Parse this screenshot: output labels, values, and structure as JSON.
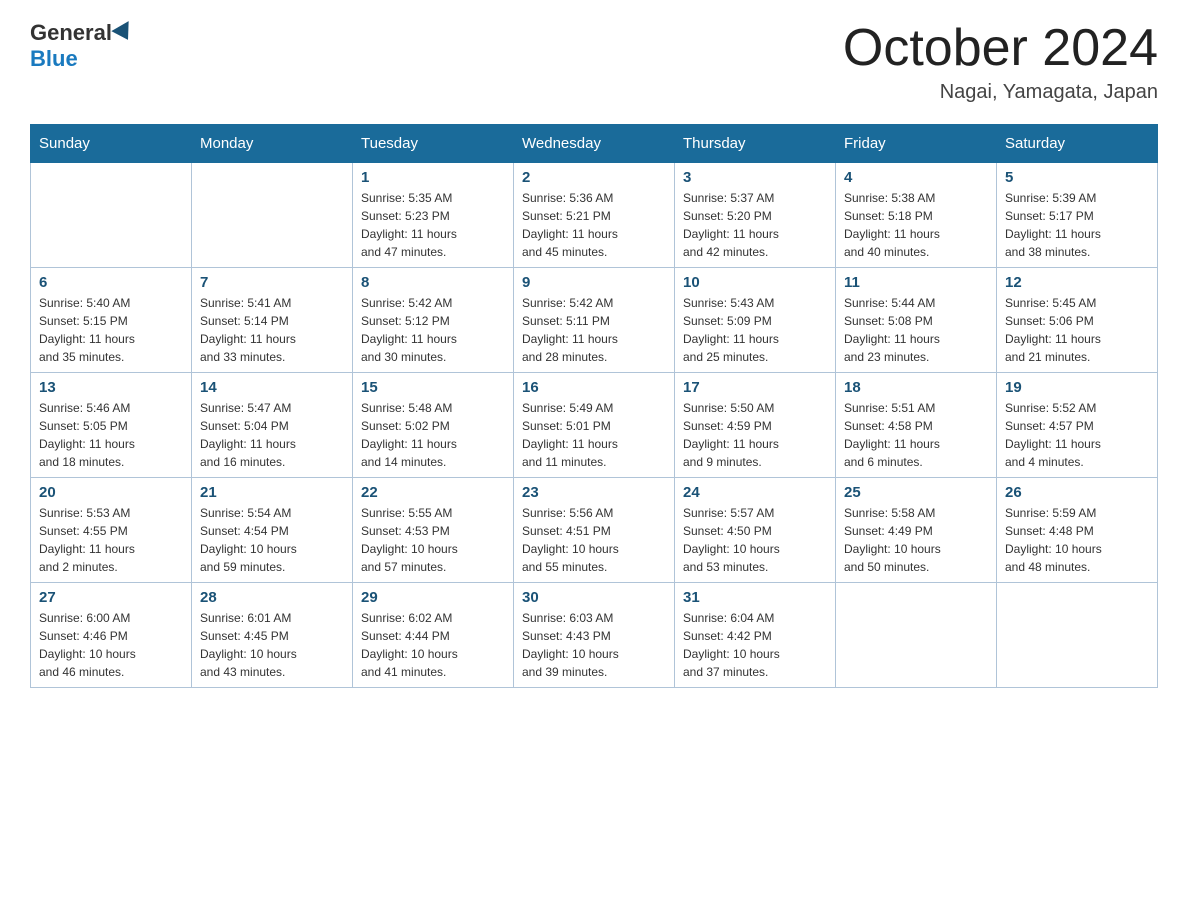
{
  "header": {
    "logo_general": "General",
    "logo_blue": "Blue",
    "month_title": "October 2024",
    "location": "Nagai, Yamagata, Japan"
  },
  "days_of_week": [
    "Sunday",
    "Monday",
    "Tuesday",
    "Wednesday",
    "Thursday",
    "Friday",
    "Saturday"
  ],
  "weeks": [
    [
      {
        "day": "",
        "info": ""
      },
      {
        "day": "",
        "info": ""
      },
      {
        "day": "1",
        "info": "Sunrise: 5:35 AM\nSunset: 5:23 PM\nDaylight: 11 hours\nand 47 minutes."
      },
      {
        "day": "2",
        "info": "Sunrise: 5:36 AM\nSunset: 5:21 PM\nDaylight: 11 hours\nand 45 minutes."
      },
      {
        "day": "3",
        "info": "Sunrise: 5:37 AM\nSunset: 5:20 PM\nDaylight: 11 hours\nand 42 minutes."
      },
      {
        "day": "4",
        "info": "Sunrise: 5:38 AM\nSunset: 5:18 PM\nDaylight: 11 hours\nand 40 minutes."
      },
      {
        "day": "5",
        "info": "Sunrise: 5:39 AM\nSunset: 5:17 PM\nDaylight: 11 hours\nand 38 minutes."
      }
    ],
    [
      {
        "day": "6",
        "info": "Sunrise: 5:40 AM\nSunset: 5:15 PM\nDaylight: 11 hours\nand 35 minutes."
      },
      {
        "day": "7",
        "info": "Sunrise: 5:41 AM\nSunset: 5:14 PM\nDaylight: 11 hours\nand 33 minutes."
      },
      {
        "day": "8",
        "info": "Sunrise: 5:42 AM\nSunset: 5:12 PM\nDaylight: 11 hours\nand 30 minutes."
      },
      {
        "day": "9",
        "info": "Sunrise: 5:42 AM\nSunset: 5:11 PM\nDaylight: 11 hours\nand 28 minutes."
      },
      {
        "day": "10",
        "info": "Sunrise: 5:43 AM\nSunset: 5:09 PM\nDaylight: 11 hours\nand 25 minutes."
      },
      {
        "day": "11",
        "info": "Sunrise: 5:44 AM\nSunset: 5:08 PM\nDaylight: 11 hours\nand 23 minutes."
      },
      {
        "day": "12",
        "info": "Sunrise: 5:45 AM\nSunset: 5:06 PM\nDaylight: 11 hours\nand 21 minutes."
      }
    ],
    [
      {
        "day": "13",
        "info": "Sunrise: 5:46 AM\nSunset: 5:05 PM\nDaylight: 11 hours\nand 18 minutes."
      },
      {
        "day": "14",
        "info": "Sunrise: 5:47 AM\nSunset: 5:04 PM\nDaylight: 11 hours\nand 16 minutes."
      },
      {
        "day": "15",
        "info": "Sunrise: 5:48 AM\nSunset: 5:02 PM\nDaylight: 11 hours\nand 14 minutes."
      },
      {
        "day": "16",
        "info": "Sunrise: 5:49 AM\nSunset: 5:01 PM\nDaylight: 11 hours\nand 11 minutes."
      },
      {
        "day": "17",
        "info": "Sunrise: 5:50 AM\nSunset: 4:59 PM\nDaylight: 11 hours\nand 9 minutes."
      },
      {
        "day": "18",
        "info": "Sunrise: 5:51 AM\nSunset: 4:58 PM\nDaylight: 11 hours\nand 6 minutes."
      },
      {
        "day": "19",
        "info": "Sunrise: 5:52 AM\nSunset: 4:57 PM\nDaylight: 11 hours\nand 4 minutes."
      }
    ],
    [
      {
        "day": "20",
        "info": "Sunrise: 5:53 AM\nSunset: 4:55 PM\nDaylight: 11 hours\nand 2 minutes."
      },
      {
        "day": "21",
        "info": "Sunrise: 5:54 AM\nSunset: 4:54 PM\nDaylight: 10 hours\nand 59 minutes."
      },
      {
        "day": "22",
        "info": "Sunrise: 5:55 AM\nSunset: 4:53 PM\nDaylight: 10 hours\nand 57 minutes."
      },
      {
        "day": "23",
        "info": "Sunrise: 5:56 AM\nSunset: 4:51 PM\nDaylight: 10 hours\nand 55 minutes."
      },
      {
        "day": "24",
        "info": "Sunrise: 5:57 AM\nSunset: 4:50 PM\nDaylight: 10 hours\nand 53 minutes."
      },
      {
        "day": "25",
        "info": "Sunrise: 5:58 AM\nSunset: 4:49 PM\nDaylight: 10 hours\nand 50 minutes."
      },
      {
        "day": "26",
        "info": "Sunrise: 5:59 AM\nSunset: 4:48 PM\nDaylight: 10 hours\nand 48 minutes."
      }
    ],
    [
      {
        "day": "27",
        "info": "Sunrise: 6:00 AM\nSunset: 4:46 PM\nDaylight: 10 hours\nand 46 minutes."
      },
      {
        "day": "28",
        "info": "Sunrise: 6:01 AM\nSunset: 4:45 PM\nDaylight: 10 hours\nand 43 minutes."
      },
      {
        "day": "29",
        "info": "Sunrise: 6:02 AM\nSunset: 4:44 PM\nDaylight: 10 hours\nand 41 minutes."
      },
      {
        "day": "30",
        "info": "Sunrise: 6:03 AM\nSunset: 4:43 PM\nDaylight: 10 hours\nand 39 minutes."
      },
      {
        "day": "31",
        "info": "Sunrise: 6:04 AM\nSunset: 4:42 PM\nDaylight: 10 hours\nand 37 minutes."
      },
      {
        "day": "",
        "info": ""
      },
      {
        "day": "",
        "info": ""
      }
    ]
  ]
}
